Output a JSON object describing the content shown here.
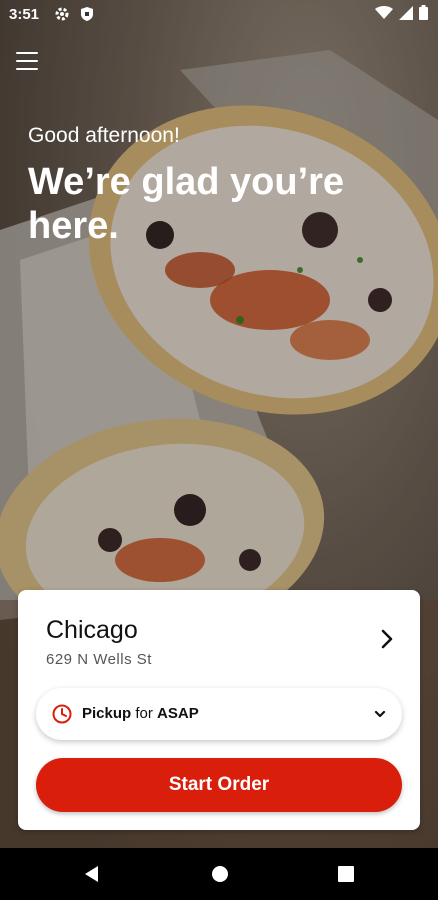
{
  "status_bar": {
    "time": "3:51"
  },
  "greeting": "Good afternoon!",
  "headline": "We’re glad you’re here.",
  "location": {
    "name": "Chicago",
    "address": "629 N Wells St"
  },
  "pickup": {
    "mode": "Pickup",
    "connector": "for",
    "time": "ASAP"
  },
  "start_order_label": "Start Order",
  "colors": {
    "accent": "#d91e0c",
    "card": "#ffffff"
  }
}
